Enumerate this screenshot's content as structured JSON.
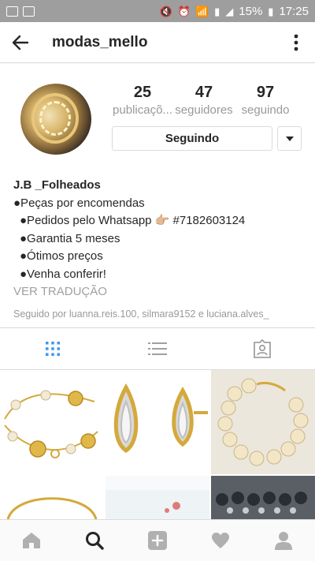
{
  "status_bar": {
    "battery": "15%",
    "time": "17:25"
  },
  "header": {
    "username": "modas_mello"
  },
  "profile": {
    "stats": [
      {
        "value": "25",
        "label": "publicaçõ..."
      },
      {
        "value": "47",
        "label": "seguidores"
      },
      {
        "value": "97",
        "label": "seguindo"
      }
    ],
    "follow_button_label": "Seguindo"
  },
  "bio": {
    "name": "J.B _Folheados",
    "lines": [
      "●Peças por encomendas",
      "●Pedidos pelo Whatsapp 👉🏼 #7182603124",
      "●Garantia 5 meses",
      "●Ótimos preços",
      "●Venha conferir!"
    ],
    "translate_label": "VER TRADUÇÃO",
    "followed_by": "Seguido por luanna.reis.100, silmara9152 e luciana.alves_"
  },
  "view_tabs": [
    {
      "icon": "grid-icon",
      "active": true
    },
    {
      "icon": "list-icon",
      "active": false
    },
    {
      "icon": "tagged-icon",
      "active": false
    }
  ],
  "bottom_nav": [
    {
      "icon": "home-icon"
    },
    {
      "icon": "search-icon"
    },
    {
      "icon": "add-post-icon"
    },
    {
      "icon": "activity-heart-icon"
    },
    {
      "icon": "profile-icon"
    }
  ],
  "colors": {
    "accent_blue": "#3897f0",
    "status_bar_bg": "#9e9e9e",
    "muted_text": "#999999",
    "border": "#dbdbdb"
  }
}
